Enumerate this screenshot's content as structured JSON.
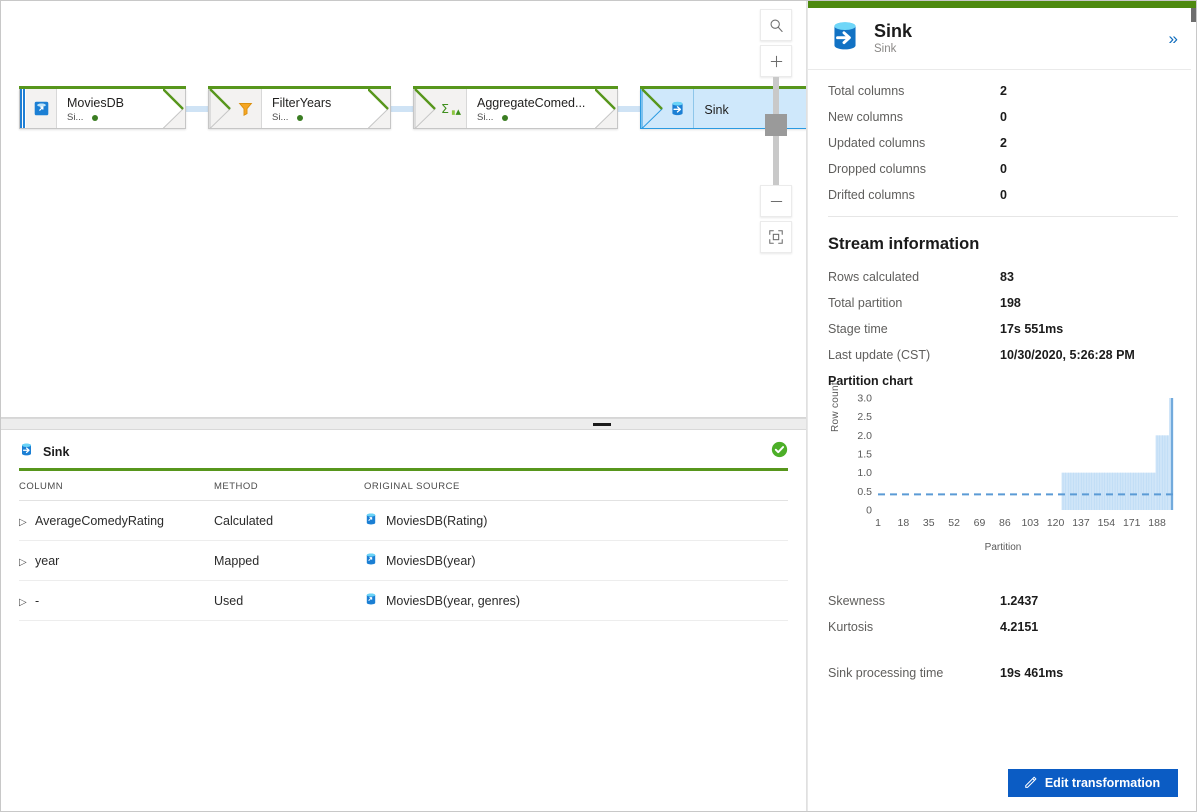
{
  "canvas": {
    "zoom_tools": [
      {
        "name": "search",
        "glyph": "search-icon"
      },
      {
        "name": "zoom-in",
        "glyph": "plus-icon"
      },
      {
        "name": "zoom-out",
        "glyph": "minus-icon"
      },
      {
        "name": "fit-to-screen",
        "glyph": "fit-screen-icon"
      }
    ],
    "nodes": [
      {
        "title": "MoviesDB",
        "subtitle": "Si...",
        "icon": "source-database-icon",
        "selected": false,
        "status": "ok"
      },
      {
        "title": "FilterYears",
        "subtitle": "Si...",
        "icon": "filter-funnel-icon",
        "selected": false,
        "status": "ok"
      },
      {
        "title": "AggregateComed...",
        "subtitle": "Si...",
        "icon": "aggregate-sigma-icon",
        "selected": false,
        "status": "ok"
      },
      {
        "title": "Sink",
        "subtitle": "",
        "icon": "sink-database-icon",
        "selected": true,
        "status": "ok"
      }
    ]
  },
  "bottom_panel": {
    "title": "Sink",
    "icon": "sink-database-icon",
    "status_icon": "success-check-icon",
    "columns": [
      "COLUMN",
      "METHOD",
      "ORIGINAL SOURCE"
    ],
    "rows": [
      {
        "column": "AverageComedyRating",
        "method": "Calculated",
        "source": "MoviesDB(Rating)"
      },
      {
        "column": "year",
        "method": "Mapped",
        "source": "MoviesDB(year)"
      },
      {
        "column": "-",
        "method": "Used",
        "source": "MoviesDB(year, genres)"
      }
    ]
  },
  "details": {
    "header": {
      "title": "Sink",
      "subtitle": "Sink",
      "icon": "sink-database-icon",
      "collapse_icon": "double-chevron-right-icon"
    },
    "column_stats": [
      {
        "label": "Total columns",
        "value": "2"
      },
      {
        "label": "New columns",
        "value": "0"
      },
      {
        "label": "Updated columns",
        "value": "2"
      },
      {
        "label": "Dropped columns",
        "value": "0"
      },
      {
        "label": "Drifted columns",
        "value": "0"
      }
    ],
    "stream_section_title": "Stream information",
    "stream_stats": [
      {
        "label": "Rows calculated",
        "value": "83"
      },
      {
        "label": "Total partition",
        "value": "198"
      },
      {
        "label": "Stage time",
        "value": "17s 551ms"
      },
      {
        "label": "Last update (CST)",
        "value": "10/30/2020, 5:26:28 PM"
      }
    ],
    "chart_title": "Partition chart",
    "distribution_stats": [
      {
        "label": "Skewness",
        "value": "1.2437"
      },
      {
        "label": "Kurtosis",
        "value": "4.2151"
      }
    ],
    "processing": [
      {
        "label": "Sink processing time",
        "value": "19s 461ms"
      }
    ],
    "edit_button": {
      "label": "Edit transformation",
      "icon": "pencil-icon"
    }
  },
  "chart_data": {
    "type": "bar",
    "title": "Partition chart",
    "xlabel": "Partition",
    "ylabel": "Row count",
    "xlim": [
      1,
      198
    ],
    "ylim": [
      0,
      3.0
    ],
    "xticks": [
      1,
      18,
      35,
      52,
      69,
      86,
      103,
      120,
      137,
      154,
      171,
      188
    ],
    "yticks": [
      "0",
      "0.5",
      "1.0",
      "1.5",
      "2.0",
      "2.5",
      "3.0"
    ],
    "grid": false,
    "legend": "none",
    "bar_color": "#cfe5f8",
    "mean_line": {
      "value": 0.42,
      "style": "dashed",
      "color": "#5b9bd5"
    },
    "series": [
      {
        "name": "Row count",
        "note": "Partitions 1-123 have 0 rows; 124-186 have 1 row; 187-195 have 2 rows; 196-198 spike to 3 rows",
        "segments": [
          {
            "from": 1,
            "to": 123,
            "value": 0
          },
          {
            "from": 124,
            "to": 186,
            "value": 1
          },
          {
            "from": 187,
            "to": 195,
            "value": 2
          },
          {
            "from": 196,
            "to": 198,
            "value": 3
          }
        ]
      }
    ]
  }
}
